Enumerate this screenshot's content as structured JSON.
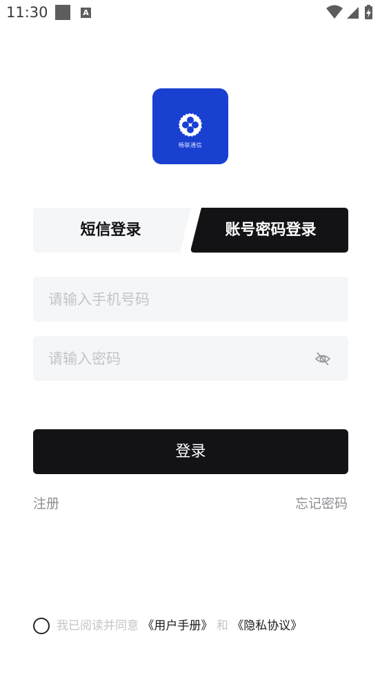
{
  "status_bar": {
    "time": "11:30",
    "notification_icons": [
      "square-notification-icon",
      "a-notification-icon"
    ],
    "right_icons": [
      "wifi-icon",
      "signal-icon",
      "battery-charging-icon"
    ]
  },
  "logo": {
    "text": "畅联通信",
    "color": "#1a40d2"
  },
  "tabs": [
    {
      "label": "短信登录",
      "active": false
    },
    {
      "label": "账号密码登录",
      "active": true
    }
  ],
  "form": {
    "phone_placeholder": "请输入手机号码",
    "phone_value": "",
    "password_placeholder": "请输入密码",
    "password_value": ""
  },
  "login_button": "登录",
  "links": {
    "register": "注册",
    "forgot_password": "忘记密码"
  },
  "agreement": {
    "prefix": "我已阅读并同意",
    "user_manual": "《用户手册》",
    "and": "和",
    "privacy": "《隐私协议》"
  },
  "colors": {
    "brand": "#1a40d2",
    "primary_dark": "#131316",
    "input_bg": "#f5f6f8",
    "muted_text": "#c3c4c8"
  }
}
